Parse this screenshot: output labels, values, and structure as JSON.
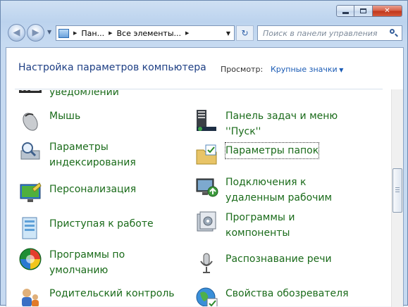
{
  "window": {
    "caption_buttons": [
      "minimize",
      "maximize",
      "close"
    ]
  },
  "address_bar": {
    "segments": [
      "Пан...",
      "Все элементы..."
    ],
    "search_placeholder": "Поиск в панели управления"
  },
  "header": {
    "title": "Настройка параметров компьютера",
    "view_label": "Просмотр:",
    "view_value": "Крупные значки"
  },
  "items": {
    "cut_label": "уведомлений",
    "mouse": "Мышь",
    "taskbar": "Панель задач и меню\n''Пуск''",
    "indexing": "Параметры\nиндексирования",
    "folder_options": "Параметры папок",
    "personalization": "Персонализация",
    "remote": "Подключения к\nудаленным рабочим",
    "getting_started": "Приступая к работе",
    "programs": "Программы и\nкомпоненты",
    "default_programs": "Программы по\nумолчанию",
    "speech": "Распознавание речи",
    "parental": "Родительский контроль",
    "internet_options": "Свойства обозревателя"
  },
  "colors": {
    "link_green": "#1a6b1a",
    "title_blue": "#1e3f84",
    "accent_blue": "#1a5bb5"
  }
}
